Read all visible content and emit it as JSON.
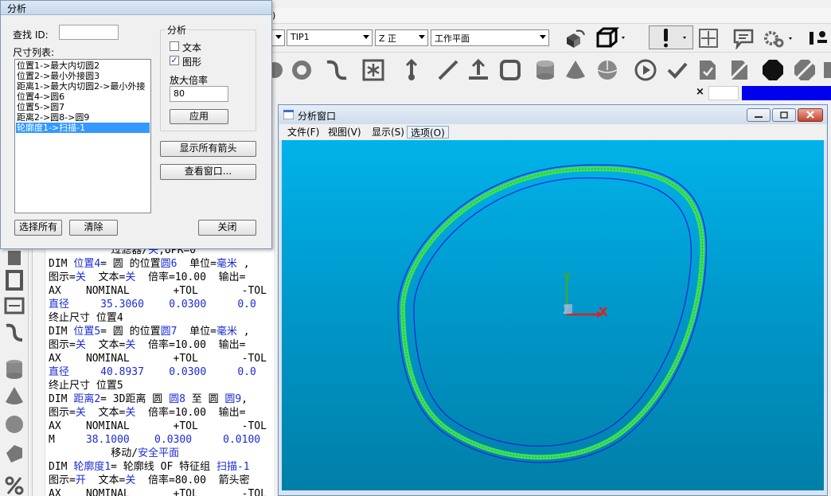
{
  "app": {
    "menubar_fragment": ")",
    "toolbar": {
      "combo1_value": "",
      "probe_combo_value": "TIP1",
      "view_combo_value": "Z 正",
      "plane_combo_value": "工作平面"
    },
    "strip_close_mark": "×"
  },
  "dialog": {
    "title": "分析",
    "find_id_label": "查找 ID:",
    "find_id_value": "",
    "dim_list_label": "尺寸列表:",
    "dim_list_items": [
      "位置1->最大内切圆2",
      "位置2->最小外接圆3",
      "距离1->最大内切圆2->最小外接",
      "位置4->圆6",
      "位置5->圆7",
      "距离2->圆8->圆9",
      "轮廓度1->扫描-1"
    ],
    "selected_index": 6,
    "analysis_group_title": "分析",
    "text_checkbox_label": "文本",
    "text_checked": false,
    "graphic_checkbox_label": "图形",
    "graphic_checked": true,
    "magnify_label": "放大倍率",
    "magnify_value": "80",
    "apply_button": "应用",
    "show_arrows_button": "显示所有箭头",
    "view_window_button": "查看窗口...",
    "select_all_button": "选择所有",
    "clear_button": "清除",
    "close_button": "关闭"
  },
  "report": {
    "lines": [
      {
        "segments": [
          {
            "t": "          过滤器/",
            "c": ""
          },
          {
            "t": "关",
            "c": "blue"
          },
          {
            "t": ",UPR=0",
            "c": ""
          }
        ]
      },
      {
        "segments": [
          {
            "t": "DIM ",
            "c": ""
          },
          {
            "t": "位置4",
            "c": "blue"
          },
          {
            "t": "= 圆 的位置",
            "c": ""
          },
          {
            "t": "圆6",
            "c": "blue"
          },
          {
            "t": "  单位=",
            "c": ""
          },
          {
            "t": "毫米",
            "c": "blue"
          },
          {
            "t": " ,",
            "c": ""
          }
        ]
      },
      {
        "segments": [
          {
            "t": "图示=",
            "c": ""
          },
          {
            "t": "关",
            "c": "blue"
          },
          {
            "t": "  文本=",
            "c": ""
          },
          {
            "t": "关",
            "c": "blue"
          },
          {
            "t": "  倍率=10.00  输出=",
            "c": ""
          }
        ]
      },
      {
        "segments": [
          {
            "t": "AX    NOMINAL       +TOL       -TOL",
            "c": ""
          }
        ]
      },
      {
        "segments": [
          {
            "t": "直径",
            "c": "blue"
          },
          {
            "t": "     35.3060    0.0300     0.0",
            "c": "blue"
          }
        ]
      },
      {
        "segments": [
          {
            "t": "终止尺寸 位置4",
            "c": ""
          }
        ]
      },
      {
        "segments": [
          {
            "t": "DIM ",
            "c": ""
          },
          {
            "t": "位置5",
            "c": "blue"
          },
          {
            "t": "= 圆 的位置",
            "c": ""
          },
          {
            "t": "圆7",
            "c": "blue"
          },
          {
            "t": "  单位=",
            "c": ""
          },
          {
            "t": "毫米",
            "c": "blue"
          },
          {
            "t": " ,",
            "c": ""
          }
        ]
      },
      {
        "segments": [
          {
            "t": "图示=",
            "c": ""
          },
          {
            "t": "关",
            "c": "blue"
          },
          {
            "t": "  文本=",
            "c": ""
          },
          {
            "t": "关",
            "c": "blue"
          },
          {
            "t": "  倍率=10.00  输出=",
            "c": ""
          }
        ]
      },
      {
        "segments": [
          {
            "t": "AX    NOMINAL       +TOL       -TOL",
            "c": ""
          }
        ]
      },
      {
        "segments": [
          {
            "t": "直径",
            "c": "blue"
          },
          {
            "t": "     40.8937    0.0300     0.0",
            "c": "blue"
          }
        ]
      },
      {
        "segments": [
          {
            "t": "终止尺寸 位置5",
            "c": ""
          }
        ]
      },
      {
        "segments": [
          {
            "t": "DIM ",
            "c": ""
          },
          {
            "t": "距离2",
            "c": "blue"
          },
          {
            "t": "= 3D距离 圆 ",
            "c": ""
          },
          {
            "t": "圆8",
            "c": "blue"
          },
          {
            "t": " 至 圆 ",
            "c": ""
          },
          {
            "t": "圆9",
            "c": "blue"
          },
          {
            "t": ",",
            "c": ""
          }
        ]
      },
      {
        "segments": [
          {
            "t": "图示=",
            "c": ""
          },
          {
            "t": "关",
            "c": "blue"
          },
          {
            "t": "  文本=",
            "c": ""
          },
          {
            "t": "关",
            "c": "blue"
          },
          {
            "t": "  倍率=10.00  输出=",
            "c": ""
          }
        ]
      },
      {
        "segments": [
          {
            "t": "AX    NOMINAL       +TOL       -TOL",
            "c": ""
          }
        ]
      },
      {
        "segments": [
          {
            "t": "M",
            "c": ""
          },
          {
            "t": "     38.1000    0.0300     0.0100",
            "c": "blue"
          }
        ]
      },
      {
        "segments": [
          {
            "t": "          移动/",
            "c": ""
          },
          {
            "t": "安全平面",
            "c": "blue"
          }
        ]
      },
      {
        "segments": [
          {
            "t": "DIM ",
            "c": ""
          },
          {
            "t": "轮廓度1",
            "c": "blue"
          },
          {
            "t": "= 轮廓线 OF 特征组 ",
            "c": ""
          },
          {
            "t": "扫描-1",
            "c": "blue"
          }
        ]
      },
      {
        "segments": [
          {
            "t": "图示=",
            "c": ""
          },
          {
            "t": "开",
            "c": "blue"
          },
          {
            "t": "  文本=",
            "c": ""
          },
          {
            "t": "关",
            "c": "blue"
          },
          {
            "t": "  倍率=80.00  箭头密",
            "c": ""
          }
        ]
      },
      {
        "segments": [
          {
            "t": "AX    NOMINAL       +TOL       -TOL",
            "c": ""
          }
        ]
      }
    ]
  },
  "analysis_window": {
    "title": "分析窗口",
    "menus": [
      "文件(F)",
      "视图(V)",
      "显示(S)",
      "选项(O)"
    ],
    "active_menu_index": 3,
    "axis_x": "X",
    "axis_y": "Y",
    "axis_z": "Z",
    "colors": {
      "viewport_top": "#00b3ea",
      "viewport_bottom": "#007fa8",
      "tolerance_band": "#1a2bd6",
      "profile_band": "#3ee05a",
      "axis_x": "#e0201e",
      "axis_y": "#3ca83c",
      "axis_z": "#9fb8d8"
    }
  }
}
